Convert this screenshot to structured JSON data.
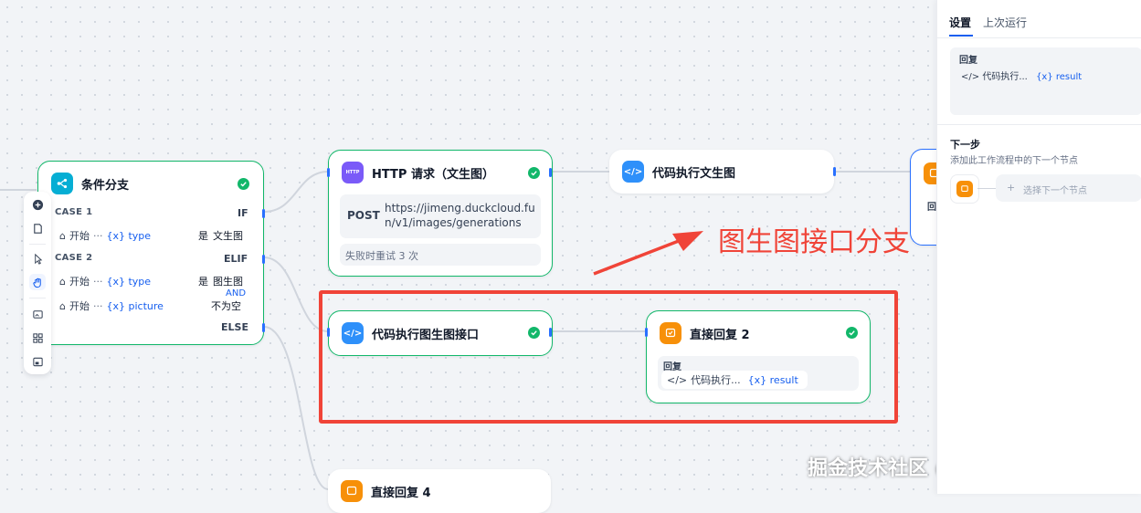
{
  "nodes": {
    "if_else": {
      "title": "条件分支",
      "case1": {
        "label": "CASE 1",
        "branch": "IF",
        "source": "开始",
        "dots": "···",
        "var": "{x} type",
        "op": "是",
        "value": "文生图"
      },
      "case2": {
        "label": "CASE 2",
        "branch": "ELIF",
        "logic": "AND",
        "cond1": {
          "source": "开始",
          "dots": "···",
          "var": "{x} type",
          "op": "是",
          "value": "图生图"
        },
        "cond2": {
          "source": "开始",
          "dots": "···",
          "var": "{x} picture",
          "op": "不为空"
        }
      },
      "else_label": "ELSE"
    },
    "http": {
      "title": "HTTP 请求（文生图）",
      "method": "POST",
      "url_line1": "https://jimeng.duckcloud.fu",
      "url_line2": "n/v1/images/generations",
      "retry": "失败时重试 3 次",
      "icon_text": "HTTP"
    },
    "code_t2i": {
      "title": "代码执行文生图"
    },
    "code_i2i": {
      "title": "代码执行图生图接口"
    },
    "reply2": {
      "title": "直接回复 2",
      "section": "回复",
      "source": "代码执行...",
      "var": "{x} result"
    },
    "reply4": {
      "title": "直接回复 4"
    },
    "partial_right": {
      "text": "回"
    }
  },
  "annotation": "图生图接口分支",
  "watermark": "掘金技术社区 @ wwwzhouhui",
  "panel": {
    "tabs": [
      {
        "label": "设置"
      },
      {
        "label": "上次运行"
      }
    ],
    "reply_label": "回复",
    "reply_source": "代码执行...",
    "reply_var": "{x} result",
    "next_title": "下一步",
    "next_desc": "添加此工作流程中的下一个节点",
    "next_placeholder": "选择下一个节点",
    "plus": "+"
  },
  "colors": {
    "selected_border": "#12b76a",
    "port": "#2970ff",
    "annotation": "#f04438",
    "var": "#155eef"
  }
}
